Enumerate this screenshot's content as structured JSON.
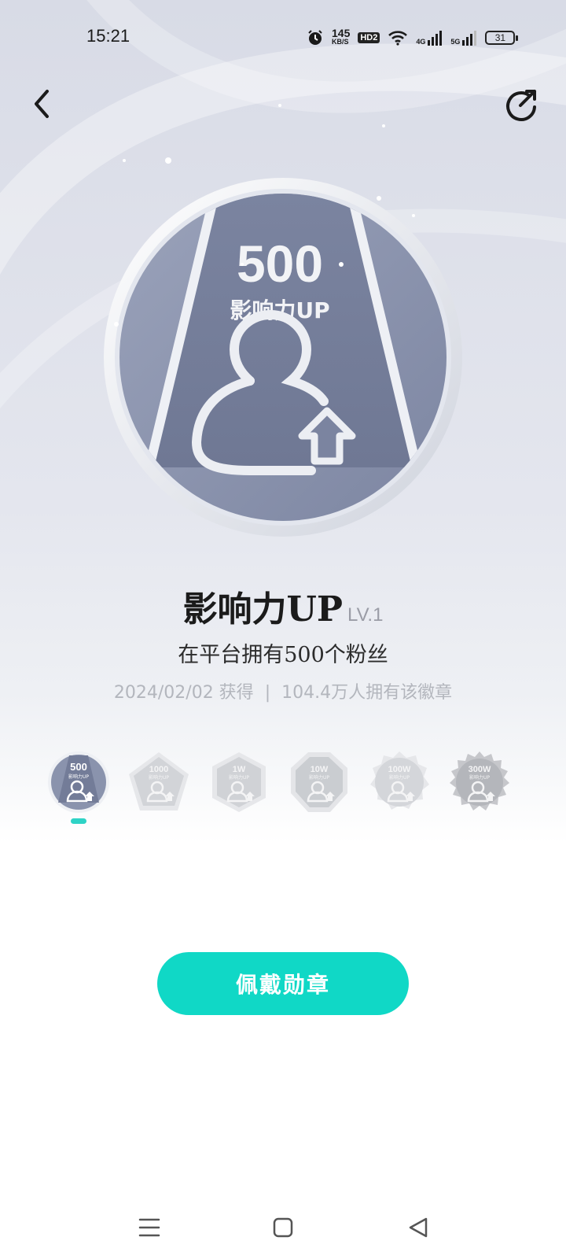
{
  "status_bar": {
    "time": "15:21",
    "net_speed_value": "145",
    "net_speed_unit": "KB/S",
    "hd_label": "HD2",
    "network_1": "4G",
    "network_2": "5G",
    "battery": "31"
  },
  "badge": {
    "count": "500",
    "name": "影响力UP",
    "level": "LV.1",
    "requirement": "在平台拥有500个粉丝",
    "earned_date": "2024/02/02 获得",
    "separator": "|",
    "holders": "104.4万人拥有该徽章"
  },
  "levels": [
    {
      "count": "500",
      "name": "影响力UP",
      "selected": true
    },
    {
      "count": "1000",
      "name": "影响力UP",
      "selected": false
    },
    {
      "count": "1W",
      "name": "影响力UP",
      "selected": false
    },
    {
      "count": "10W",
      "name": "影响力UP",
      "selected": false
    },
    {
      "count": "100W",
      "name": "影响力UP",
      "selected": false
    },
    {
      "count": "300W",
      "name": "影响力UP",
      "selected": false
    }
  ],
  "action": {
    "wear_label": "佩戴勋章"
  },
  "colors": {
    "accent": "#10d8c6",
    "badge_fill": "#8a93ad",
    "badge_rim": "#eceef3"
  }
}
